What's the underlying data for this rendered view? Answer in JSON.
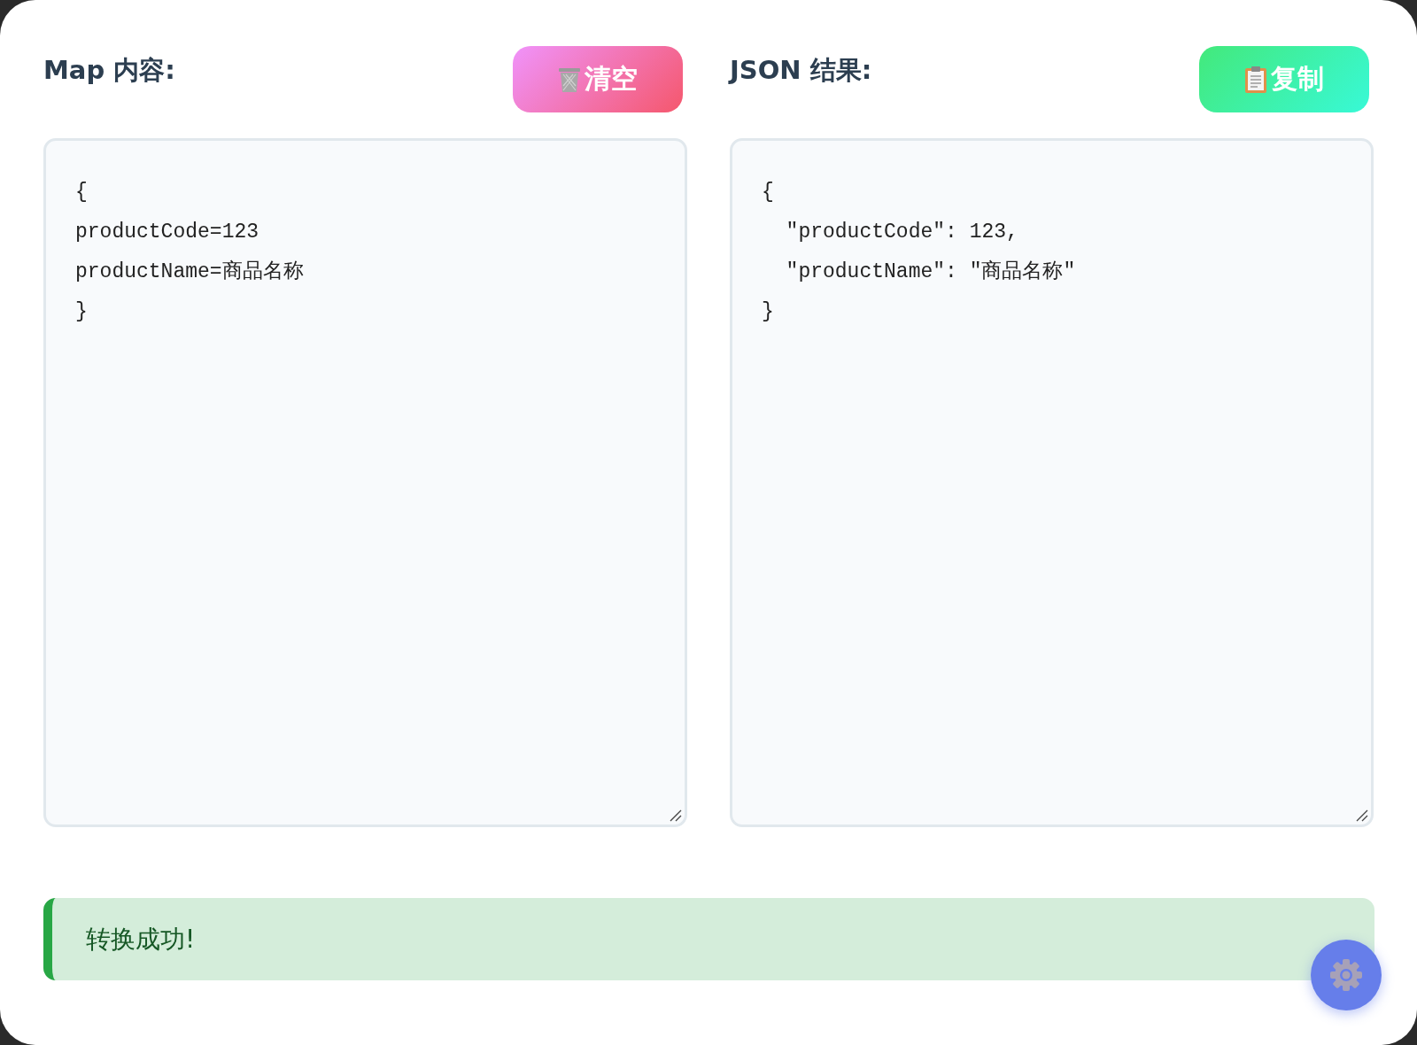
{
  "panels": [
    {
      "heading": "Map 内容:",
      "button": {
        "kind": "clear",
        "label": "清空"
      },
      "lines": [
        "{",
        "productCode=123",
        "productName=商品名称",
        "}"
      ]
    },
    {
      "heading": "JSON 结果:",
      "button": {
        "kind": "copy",
        "label": "复制"
      },
      "lines": [
        "{",
        "  \"productCode\": 123,",
        "  \"productName\": \"商品名称\"",
        "}"
      ]
    }
  ],
  "status": {
    "kind": "success",
    "message": "转换成功!"
  }
}
